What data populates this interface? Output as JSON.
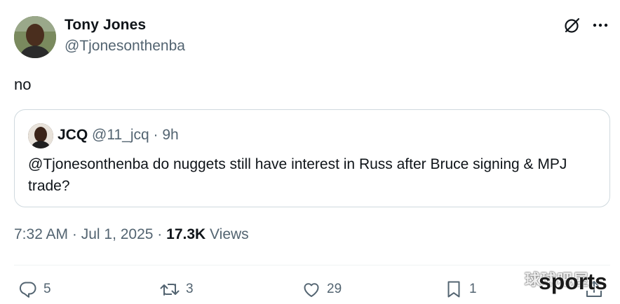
{
  "tweet": {
    "author": {
      "name": "Tony Jones",
      "handle": "@Tjonesonthenba"
    },
    "text": "no",
    "time": "7:32 AM · Jul 1, 2025",
    "separator": " · ",
    "views_count": "17.3K",
    "views_label": " Views"
  },
  "quote": {
    "author": {
      "name": "JCQ",
      "handle": "@11_jcq"
    },
    "dot": "·",
    "time": "9h",
    "text": "@Tjonesonthenba do nuggets still have interest in Russ after Bruce signing & MPJ trade?"
  },
  "actions": {
    "replies": "5",
    "retweets": "3",
    "likes": "29",
    "bookmarks": "1"
  },
  "icons": [
    "grok-icon",
    "more-icon",
    "reply-icon",
    "retweet-icon",
    "like-icon",
    "bookmark-icon",
    "share-icon"
  ],
  "watermark": {
    "cn": "球球吧屋",
    "en": "sports"
  },
  "colors": {
    "text": "#0f1419",
    "secondary": "#536471",
    "border": "#cfd9de"
  }
}
